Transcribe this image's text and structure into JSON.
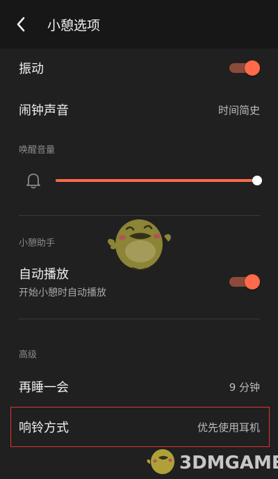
{
  "header": {
    "title": "小憩选项"
  },
  "vibrate": {
    "label": "振动",
    "enabled": true
  },
  "alarm_sound": {
    "label": "闹钟声音",
    "value": "时间简史"
  },
  "wake_volume": {
    "section": "唤醒音量",
    "level": 1.0
  },
  "assistant": {
    "section": "小憩助手",
    "autoplay_label": "自动播放",
    "autoplay_sub": "开始小憩时自动播放",
    "autoplay_enabled": true
  },
  "advanced": {
    "section": "高级",
    "snooze_label": "再睡一会",
    "snooze_value": "9 分钟",
    "ring_label": "响铃方式",
    "ring_value": "优先使用耳机"
  },
  "watermark": {
    "text": "3DMGAME"
  },
  "colors": {
    "accent": "#ff6a4a",
    "highlight_border": "#e0342c"
  },
  "icons": {
    "back": "chevron-left-icon",
    "bell": "bell-icon"
  }
}
